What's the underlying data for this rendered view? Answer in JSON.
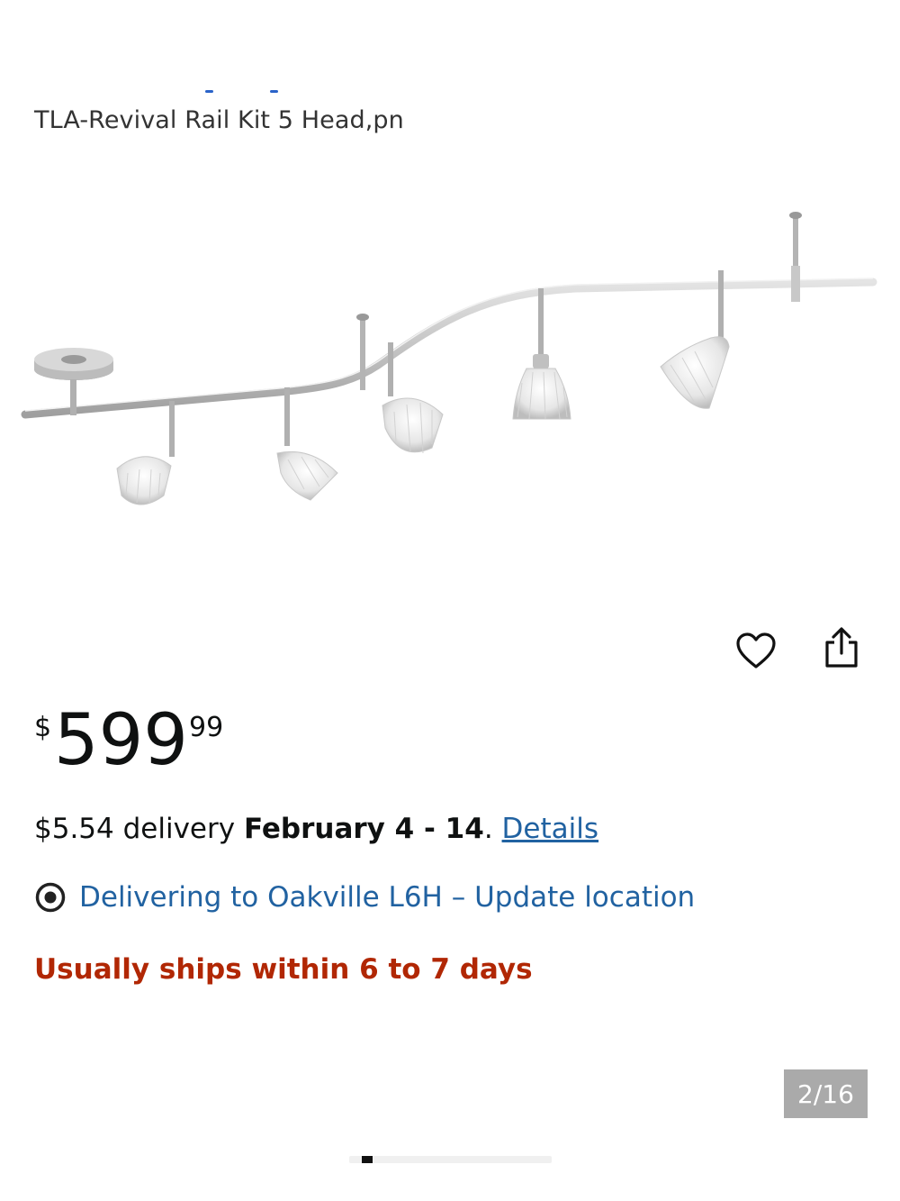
{
  "product": {
    "title": "TLA-Revival Rail Kit 5 Head,pn"
  },
  "actions": {
    "wishlist_icon": "heart-icon",
    "share_icon": "share-icon"
  },
  "price": {
    "symbol": "$",
    "whole": "599",
    "fraction": "99"
  },
  "delivery": {
    "prefix": "$5.54 delivery ",
    "dates": "February 4 - 14",
    "separator": ". ",
    "details_link": "Details"
  },
  "location": {
    "icon": "location-pin-icon",
    "text": "Delivering to Oakville L6H – Update location"
  },
  "availability": {
    "text": "Usually ships within 6 to 7 days"
  },
  "gallery": {
    "counter": "2/16",
    "current": 2,
    "total": 16
  },
  "colors": {
    "link": "#2162a1",
    "availability": "#b12704",
    "text": "#0f1111",
    "counter_bg": "#aaaaaa"
  }
}
